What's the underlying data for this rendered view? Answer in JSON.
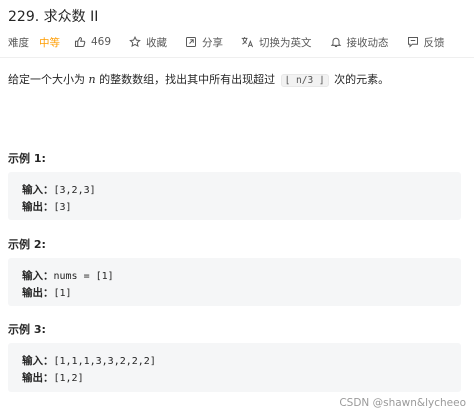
{
  "header": {
    "title": "229. 求众数 II",
    "difficulty_label": "难度",
    "difficulty_value": "中等",
    "likes": "469",
    "favorite": "收藏",
    "share": "分享",
    "switch_lang": "切换为英文",
    "notify": "接收动态",
    "feedback": "反馈"
  },
  "colors": {
    "difficulty": "#ff9c00",
    "example_bg": "#f5f6f7"
  },
  "description": {
    "part1": "给定一个大小为 ",
    "var": "n",
    "part2": " 的整数数组，找出其中所有出现超过 ",
    "code": "⌊ n/3 ⌋",
    "part3": " 次的元素。"
  },
  "examples": [
    {
      "title": "示例 1:",
      "input_label": "输入：",
      "input": "[3,2,3]",
      "output_label": "输出：",
      "output": "[3]"
    },
    {
      "title": "示例 2:",
      "input_label": "输入：",
      "input": "nums = [1]",
      "output_label": "输出：",
      "output": "[1]"
    },
    {
      "title": "示例 3:",
      "input_label": "输入：",
      "input": "[1,1,1,3,3,2,2,2]",
      "output_label": "输出：",
      "output": "[1,2]"
    }
  ],
  "watermark": "CSDN @shawn&lycheeo"
}
